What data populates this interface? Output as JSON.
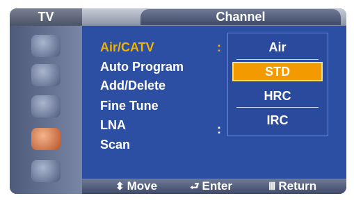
{
  "header": {
    "left_label": "TV",
    "title": "Channel"
  },
  "menu": {
    "items": [
      {
        "label": "Air/CATV",
        "colon": ":"
      },
      {
        "label": "Auto Program"
      },
      {
        "label": "Add/Delete"
      },
      {
        "label": "Fine Tune"
      },
      {
        "label": "LNA",
        "colon": ":"
      },
      {
        "label": "Scan"
      }
    ]
  },
  "dropdown": {
    "options": [
      "Air",
      "STD",
      "HRC",
      "IRC"
    ],
    "selected": "STD"
  },
  "footer": {
    "move": {
      "icon": "up-down-arrow-icon",
      "glyph": "⬍",
      "label": "Move"
    },
    "enter": {
      "icon": "enter-icon",
      "glyph": "⮐",
      "label": "Enter"
    },
    "return": {
      "icon": "menu-return-icon",
      "glyph": "Ⅲ",
      "label": "Return"
    }
  },
  "colors": {
    "accent": "#f0b400",
    "panel": "#2d4fa3",
    "selected_option": "#f29a00"
  }
}
